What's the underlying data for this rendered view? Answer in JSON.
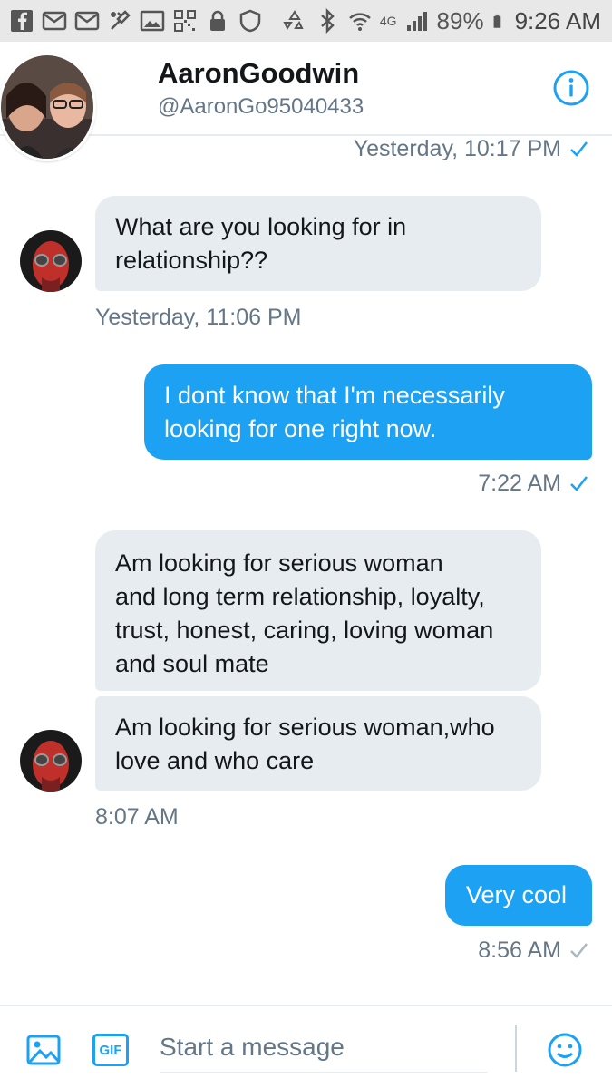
{
  "status_bar": {
    "battery": "89%",
    "time": "9:26 AM",
    "network": "4G",
    "left_icons": [
      "facebook-icon",
      "mail-icon",
      "mail-icon",
      "tools-icon",
      "image-icon",
      "qr-icon",
      "lock-icon",
      "shield-icon"
    ],
    "right_icons": [
      "recycle-icon",
      "bluetooth-icon",
      "wifi-icon",
      "signal-icon",
      "battery-icon"
    ]
  },
  "header": {
    "name": "AaronGoodwin",
    "handle": "@AaronGo95040433",
    "info_icon": "info-icon"
  },
  "messages": {
    "ts0": {
      "text": "Yesterday, 10:17 PM",
      "read": true
    },
    "m1": {
      "text1": "What are you looking for in",
      "text2": "relationship??"
    },
    "ts1": {
      "text": "Yesterday, 11:06 PM"
    },
    "m2": {
      "text1": "I dont know that I'm necessarily",
      "text2": "looking for one right now."
    },
    "ts2": {
      "text": "7:22 AM",
      "read": true
    },
    "m3": {
      "text1": "Am looking for serious woman",
      "text2": "and long term relationship, loyalty,",
      "text3": "trust, honest, caring, loving woman",
      "text4": "and soul mate"
    },
    "m4": {
      "text1": "Am looking for serious woman,who",
      "text2": "love and who care"
    },
    "ts3": {
      "text": "8:07 AM"
    },
    "m5": {
      "text1": "Very cool"
    },
    "ts4": {
      "text": "8:56 AM",
      "read": false
    }
  },
  "composer": {
    "placeholder": "Start a message",
    "gif_label": "GIF",
    "media_icon": "image-icon",
    "emoji_icon": "emoji-icon"
  },
  "colors": {
    "accent": "#1da1f2",
    "incoming_bubble": "#e6ecf0",
    "secondary_text": "#657786"
  }
}
